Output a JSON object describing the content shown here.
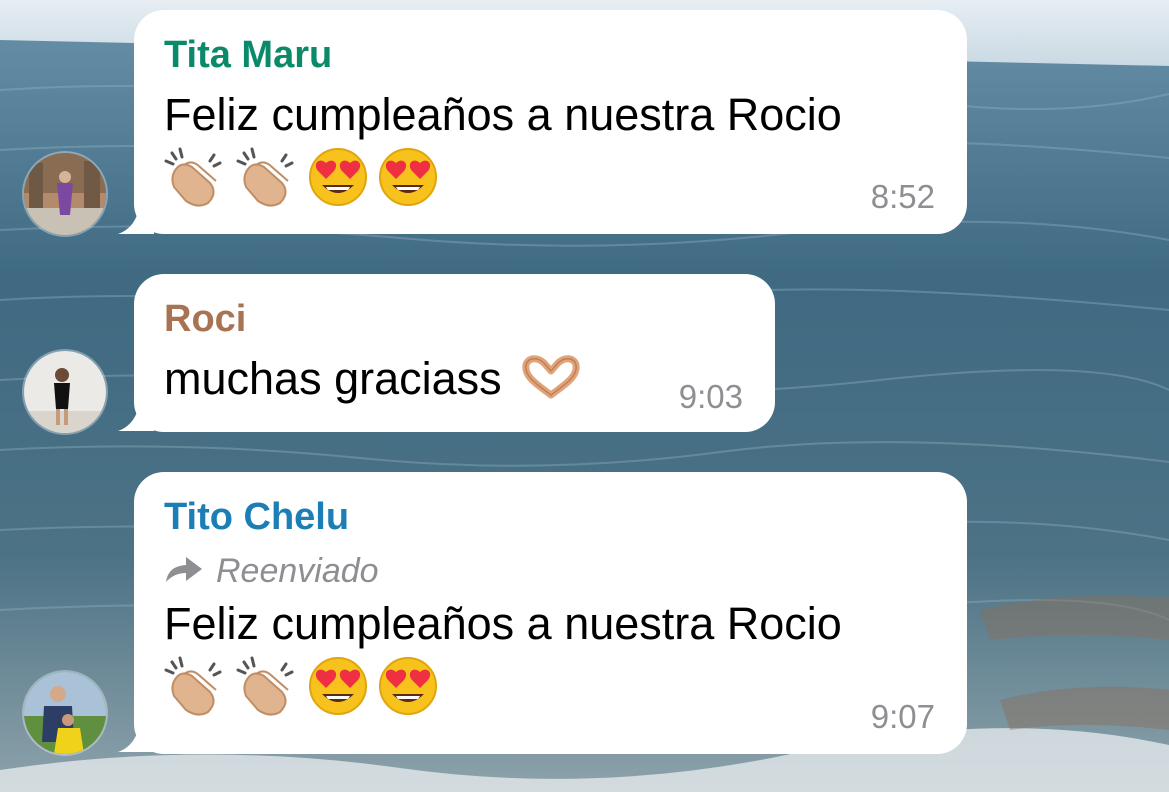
{
  "theme": {
    "sea_top": "#5d8aa3",
    "sea_mid": "#456f86",
    "sea_bottom": "#7e9aa5",
    "sky": "#d8e4ec",
    "bubble": "#ffffff",
    "time_color": "#8e8e93"
  },
  "messages": [
    {
      "sender": "Tita Maru",
      "sender_color": "#0b8a6a",
      "text": "Feliz cumpleaños a nuestra Rocio",
      "emojis": [
        "clapping-hands-emoji",
        "clapping-hands-emoji",
        "heart-eyes-emoji",
        "heart-eyes-emoji"
      ],
      "time": "8:52"
    },
    {
      "sender": "Roci",
      "sender_color": "#a87352",
      "text": "muchas graciass",
      "emojis": [
        "heart-hands-emoji"
      ],
      "time": "9:03"
    },
    {
      "sender": "Tito Chelu",
      "sender_color": "#1b7fb5",
      "forwarded_label": "Reenviado",
      "text": "Feliz cumpleaños a nuestra Rocio",
      "emojis": [
        "clapping-hands-emoji",
        "clapping-hands-emoji",
        "heart-eyes-emoji",
        "heart-eyes-emoji"
      ],
      "time": "9:07"
    }
  ]
}
